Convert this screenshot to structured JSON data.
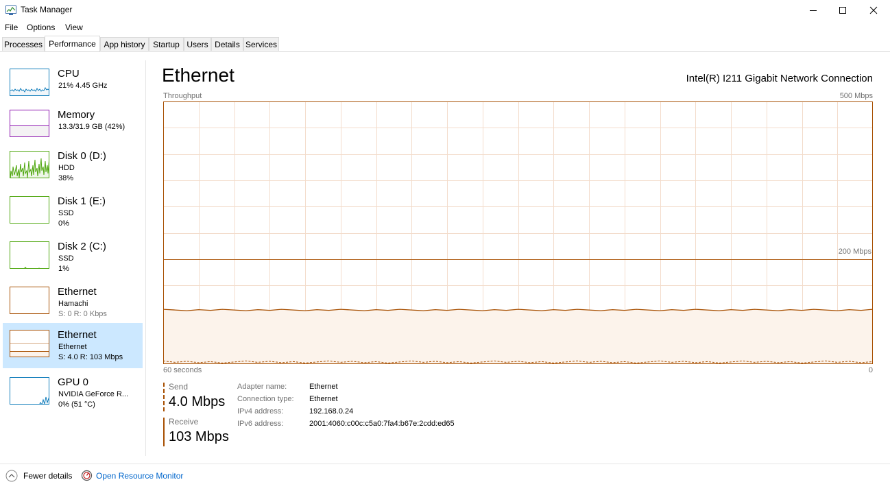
{
  "window": {
    "title": "Task Manager"
  },
  "menu": [
    "File",
    "Options",
    "View"
  ],
  "tabs": [
    "Processes",
    "Performance",
    "App history",
    "Startup",
    "Users",
    "Details",
    "Services"
  ],
  "active_tab": "Performance",
  "sidebar": {
    "items": [
      {
        "name": "CPU",
        "line1": "21%  4.45 GHz",
        "line2": "",
        "color": "#117dbb"
      },
      {
        "name": "Memory",
        "line1": "13.3/31.9 GB (42%)",
        "line2": "",
        "color": "#8b12ae"
      },
      {
        "name": "Disk 0 (D:)",
        "line1": "HDD",
        "line2": "38%",
        "color": "#4da60c"
      },
      {
        "name": "Disk 1 (E:)",
        "line1": "SSD",
        "line2": "0%",
        "color": "#4da60c"
      },
      {
        "name": "Disk 2 (C:)",
        "line1": "SSD",
        "line2": "1%",
        "color": "#4da60c"
      },
      {
        "name": "Ethernet",
        "line1": "Hamachi",
        "line2": "S: 0 R: 0 Kbps",
        "color": "#a74f01"
      },
      {
        "name": "Ethernet",
        "line1": "Ethernet",
        "line2": "S: 4.0  R: 103 Mbps",
        "color": "#a74f01"
      },
      {
        "name": "GPU 0",
        "line1": "NVIDIA GeForce R...",
        "line2": "0% (51 °C)",
        "color": "#117dbb"
      }
    ],
    "selected_index": 6
  },
  "main": {
    "title": "Ethernet",
    "device": "Intel(R) I211 Gigabit Network Connection",
    "graph": {
      "label": "Throughput",
      "max_label": "500 Mbps",
      "mid_label": "200 Mbps",
      "time_label": "60 seconds",
      "zero_label": "0",
      "accent": "#a74f01",
      "fill": "#fcf3eb",
      "grid": "#f3dccb",
      "max_mbps": 500,
      "mid_mbps": 200,
      "receive_mbps": 103,
      "send_mbps": 4.0
    },
    "send": {
      "label": "Send",
      "value": "4.0 Mbps"
    },
    "receive": {
      "label": "Receive",
      "value": "103 Mbps"
    },
    "info": [
      {
        "key": "Adapter name:",
        "value": "Ethernet"
      },
      {
        "key": "Connection type:",
        "value": "Ethernet"
      },
      {
        "key": "IPv4 address:",
        "value": "192.168.0.24"
      },
      {
        "key": "IPv6 address:",
        "value": "2001:4060:c00c:c5a0:7fa4:b67e:2cdd:ed65"
      }
    ]
  },
  "footer": {
    "fewer": "Fewer details",
    "resource_monitor": "Open Resource Monitor"
  }
}
